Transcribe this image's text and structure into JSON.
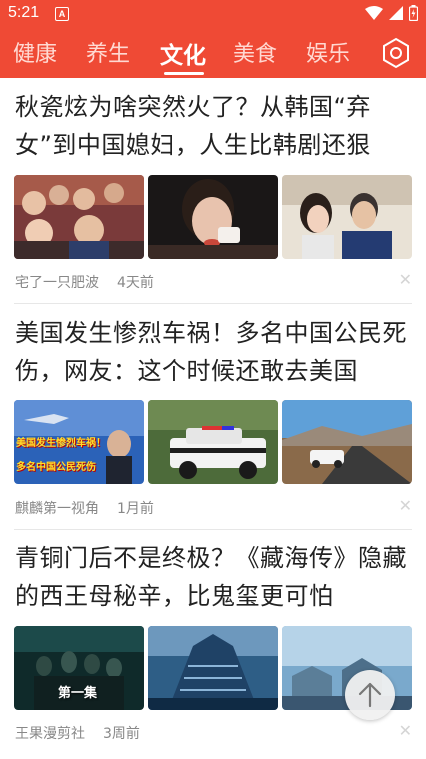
{
  "status": {
    "time": "5:21",
    "notif_badge": "A"
  },
  "tabs": [
    {
      "label": "健康"
    },
    {
      "label": "养生"
    },
    {
      "label": "文化"
    },
    {
      "label": "美食"
    },
    {
      "label": "娱乐"
    }
  ],
  "icons": {
    "settings": "settings-hexagon-icon",
    "scroll_top": "arrow-up-icon",
    "dismiss": "close-icon"
  },
  "articles": [
    {
      "title": "秋瓷炫为啥突然火了？从韩国“弃女”到中国媳妇，人生比韩剧还狠",
      "author": "宅了一只肥波",
      "time": "4天前"
    },
    {
      "title": "美国发生惨烈车祸！多名中国公民死伤，网友：这个时候还敢去美国",
      "author": "麒麟第一视角",
      "time": "1月前",
      "image_caption_1": "美国发生惨烈车祸！",
      "image_caption_2": "多名中国公民死伤"
    },
    {
      "title": "青铜门后不是终极？《藏海传》隐藏的西王母秘辛，比鬼玺更可怕",
      "author": "王果漫剪社",
      "time": "3周前",
      "image_caption_1": "第一集"
    }
  ],
  "colors": {
    "accent": "#ef4a35",
    "tab_active": "#ffffff",
    "tab_inactive": "#ffd9d2",
    "meta_text": "#888888"
  }
}
